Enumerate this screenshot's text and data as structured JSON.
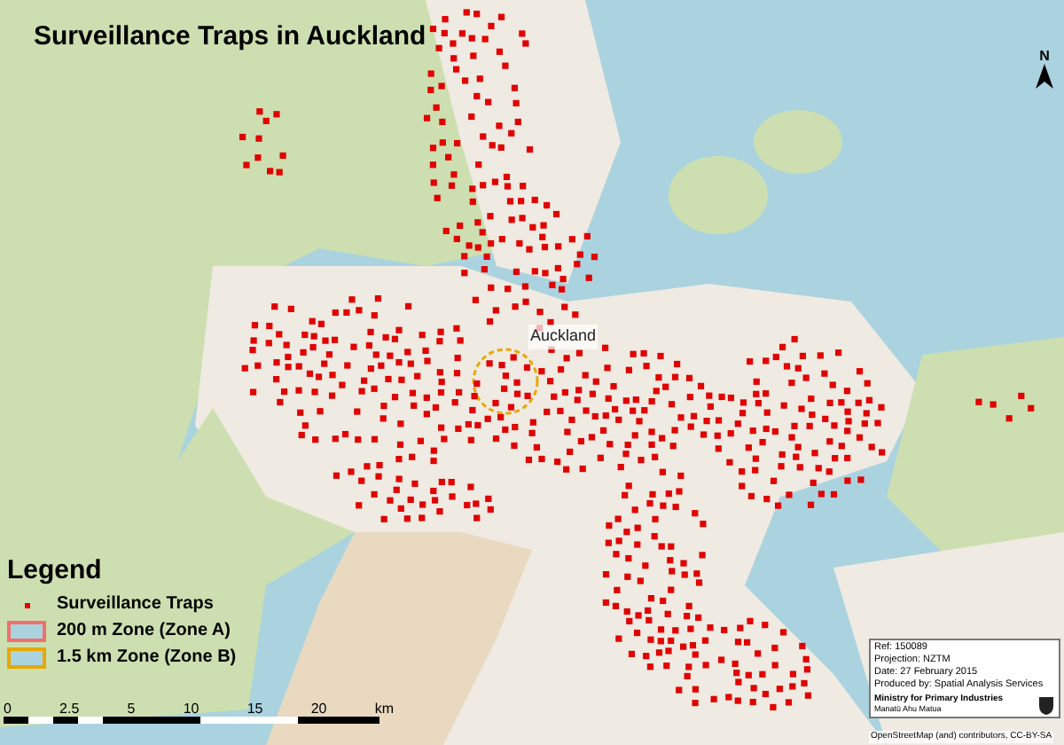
{
  "title": "Surveillance Traps in Auckland",
  "map_labels": [
    {
      "text": "Auckland"
    }
  ],
  "legend": {
    "heading": "Legend",
    "items": [
      {
        "kind": "dot",
        "label": "Surveillance Traps",
        "color": "#e00000"
      },
      {
        "kind": "zone",
        "label": "200 m Zone (Zone A)",
        "color": "#f07070"
      },
      {
        "kind": "zone",
        "label": "1.5 km Zone (Zone B)",
        "color": "#e8a800"
      }
    ]
  },
  "scale_bar": {
    "ticks": [
      "0",
      "2.5",
      "5",
      "10",
      "15",
      "20"
    ],
    "unit": "km"
  },
  "info": {
    "lines": [
      "Ref: 150089",
      "Projection: NZTM",
      "Date: 27 February 2015",
      "Produced by: Spatial Analysis Services"
    ],
    "org": "Ministry for Primary Industries",
    "org_subtitle": "Manatū Ahu Matua"
  },
  "attribution": "OpenStreetMap (and) contributors, CC-BY-SA",
  "north_arrow": {
    "label": "N"
  }
}
